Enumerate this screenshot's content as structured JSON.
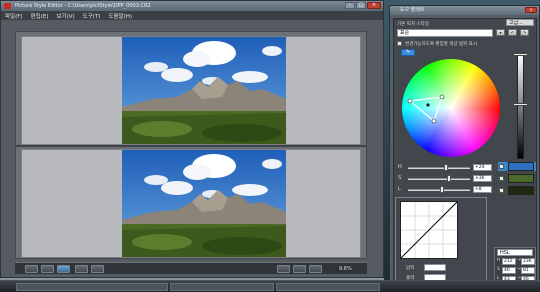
{
  "main_window": {
    "title": "Picture Style Editor - C:\\Users\\pictStyle\\DPP_0003.CR2",
    "menu": [
      "파일(F)",
      "편집(E)",
      "보기(V)",
      "도구(T)",
      "도움말(H)"
    ],
    "zoom_readout": "9.6%"
  },
  "tool_panel": {
    "title": "도구 팔레트",
    "preset_label": "기본 픽처 스타일",
    "preset_value": "표준",
    "mode_button": "고급...",
    "checkbox_label": "변경가능하도록 편집할 색상 범위 표시",
    "sliders": [
      {
        "letter": "H",
        "value": "+24",
        "pos": 0.62
      },
      {
        "letter": "S",
        "value": "+36",
        "pos": 0.68
      },
      {
        "letter": "L",
        "value": "+8",
        "pos": 0.55
      }
    ],
    "swatches": [
      {
        "color": "#2f6fc0",
        "checked": true,
        "selected": true
      },
      {
        "color": "#4a6a2c",
        "checked": true,
        "selected": false
      },
      {
        "color": "#1e2a10",
        "checked": true,
        "selected": false
      }
    ],
    "tone_labels": [
      "압력",
      "출력"
    ],
    "hsl": {
      "mode": "HSL",
      "left": [
        {
          "k": "H",
          "v": "212"
        },
        {
          "k": "S",
          "v": "46"
        },
        {
          "k": "L",
          "v": "43"
        }
      ],
      "right": [
        {
          "v": "236"
        },
        {
          "v": "81"
        },
        {
          "v": "46"
        }
      ]
    }
  },
  "taskbar": {
    "items": [
      "",
      "",
      ""
    ]
  }
}
